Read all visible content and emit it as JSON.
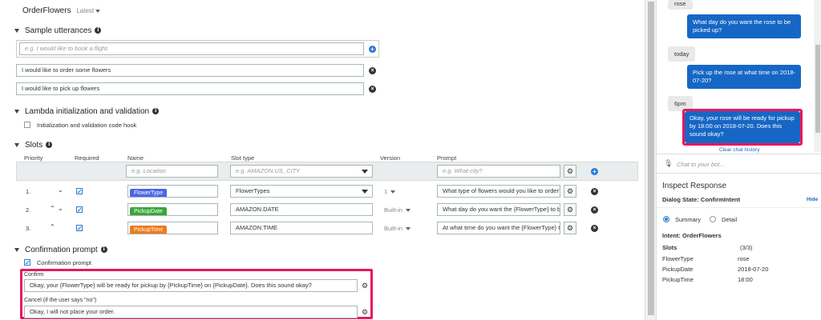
{
  "header": {
    "title": "OrderFlowers",
    "version": "Latest"
  },
  "utterances": {
    "section_label": "Sample utterances",
    "placeholder": "e.g. I would like to book a flight.",
    "items": [
      "I would like to order some flowers",
      "I would like to pick up flowers"
    ]
  },
  "lambda": {
    "section_label": "Lambda initialization and validation",
    "checkbox_label": "Initialization and validation code hook"
  },
  "slots": {
    "section_label": "Slots",
    "columns": {
      "priority": "Priority",
      "required": "Required",
      "name": "Name",
      "slot_type": "Slot type",
      "version": "Version",
      "prompt": "Prompt"
    },
    "new_row": {
      "name_placeholder": "e.g. Location",
      "type_placeholder": "e.g. AMAZON.US_CITY",
      "prompt_placeholder": "e.g. What city?"
    },
    "rows": [
      {
        "priority": "1.",
        "name": "FlowerType",
        "name_color": "#4a67e6",
        "slot_type": "FlowerTypes",
        "version": "1",
        "prompt": "What type of flowers would you like to order?"
      },
      {
        "priority": "2.",
        "name": "PickupDate",
        "name_color": "#3aa53a",
        "slot_type": "AMAZON.DATE",
        "version": "Built-in",
        "prompt": "What day do you want the {FlowerType} to be"
      },
      {
        "priority": "3.",
        "name": "PickupTime",
        "name_color": "#ef7a1a",
        "slot_type": "AMAZON.TIME",
        "version": "Built-in",
        "prompt": "At what time do you want the {FlowerType} to"
      }
    ]
  },
  "confirmation": {
    "section_label": "Confirmation prompt",
    "checkbox_label": "Confirmation prompt",
    "confirm_label": "Confirm",
    "confirm_value": "Okay, your {FlowerType} will be ready for pickup by {PickupTime} on {PickupDate}.  Does this sound okay?",
    "cancel_label": "Cancel (if the user says \"no\")",
    "cancel_value": "Okay, I will not place your order."
  },
  "chat": {
    "messages": [
      {
        "from": "user",
        "text": "rose"
      },
      {
        "from": "bot",
        "text": "What day do you want the rose to be picked up?"
      },
      {
        "from": "user",
        "text": "today"
      },
      {
        "from": "bot",
        "text": "Pick up the rose at what time on 2018-07-20?"
      },
      {
        "from": "user",
        "text": "6pm"
      },
      {
        "from": "bot",
        "text": "Okay, your rose will be ready for pickup by 18:00 on 2018-07-20. Does this sound okay?"
      }
    ],
    "clear_label": "Clear chat history",
    "input_placeholder": "Chat to your bot...",
    "highlight_color": "#e8175d",
    "bot_color": "#1667c5"
  },
  "inspect": {
    "title": "Inspect Response",
    "dialog_state_label": "Dialog State: ConfirmIntent",
    "hide_label": "Hide",
    "summary_label": "Summary",
    "detail_label": "Detail",
    "intent_label": "Intent: OrderFlowers",
    "slots_label": "Slots",
    "slots_count": "(3/3)",
    "slot_values": [
      {
        "name": "FlowerType",
        "value": "rose"
      },
      {
        "name": "PickupDate",
        "value": "2018-07-20"
      },
      {
        "name": "PickupTime",
        "value": "18:00"
      }
    ]
  }
}
